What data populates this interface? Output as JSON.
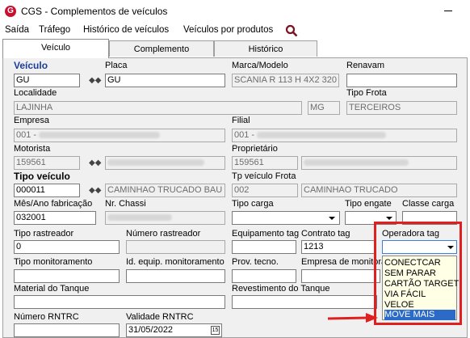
{
  "window": {
    "title": "CGS - Complementos de veículos",
    "logo_letter": "G"
  },
  "menu": [
    "Saída",
    "Tráfego",
    "Histórico de veículos",
    "Veículos por produtos"
  ],
  "tabs": [
    "Veículo",
    "Complemento",
    "Histórico"
  ],
  "form": {
    "veiculo": {
      "label": "Veículo",
      "value": "GU"
    },
    "placa": {
      "label": "Placa",
      "value": "GU"
    },
    "marca_modelo": {
      "label": "Marca/Modelo",
      "value": "SCANIA R 113 H 4X2 320"
    },
    "renavam": {
      "label": "Renavam",
      "value": ""
    },
    "localidade": {
      "label": "Localidade",
      "value": "LAJINHA",
      "uf": "MG"
    },
    "tipo_frota": {
      "label": "Tipo Frota",
      "value": "TERCEIROS"
    },
    "empresa": {
      "label": "Empresa",
      "value": "001 -"
    },
    "filial": {
      "label": "Filial",
      "value": "001 -"
    },
    "motorista": {
      "label": "Motorista",
      "value": "159561"
    },
    "proprietario": {
      "label": "Proprietário",
      "value": "159561"
    },
    "tipo_veiculo": {
      "label": "Tipo veículo",
      "code": "000011",
      "desc": "CAMINHAO TRUCADO BAU"
    },
    "tp_veiculo_frota": {
      "label": "Tp veículo Frota",
      "code": "002",
      "desc": "CAMINHAO TRUCADO"
    },
    "mes_ano_fabricacao": {
      "label": "Mês/Ano fabricação",
      "value": "032001"
    },
    "nr_chassi": {
      "label": "Nr. Chassi",
      "value": ""
    },
    "tipo_carga": {
      "label": "Tipo carga",
      "value": ""
    },
    "tipo_engate": {
      "label": "Tipo engate",
      "value": ""
    },
    "classe_carga": {
      "label": "Classe carga",
      "value": ""
    },
    "tipo_rastreador": {
      "label": "Tipo rastreador",
      "value": "0"
    },
    "numero_rastreador": {
      "label": "Número rastreador",
      "value": ""
    },
    "equipamento_tag": {
      "label": "Equipamento tag",
      "value": ""
    },
    "contrato_tag": {
      "label": "Contrato tag",
      "value": "1213"
    },
    "operadora_tag": {
      "label": "Operadora tag",
      "value": ""
    },
    "tipo_monitoramento": {
      "label": "Tipo monitoramento",
      "value": ""
    },
    "id_equip_monitoramento": {
      "label": "Id. equip. monitoramento",
      "value": ""
    },
    "prov_tecno": {
      "label": "Prov. tecno.",
      "value": ""
    },
    "empresa_monitora": {
      "label": "Empresa de monitora",
      "value": ""
    },
    "material_tanque": {
      "label": "Material do Tanque",
      "value": ""
    },
    "revestimento_tanque": {
      "label": "Revestimento do Tanque",
      "value": ""
    },
    "numero_rntrc": {
      "label": "Número RNTRC",
      "value": ""
    },
    "validade_rntrc": {
      "label": "Validade RNTRC",
      "value": "31/05/2022"
    }
  },
  "operadora_options": [
    "CONECTCAR",
    "SEM PARAR",
    "CARTÃO TARGET",
    "VIA FÁCIL",
    "VELOE",
    "MOVE MAIS"
  ],
  "operadora_selected_index": 5,
  "colors": {
    "highlight": "#e02020",
    "selection": "#2b6bc7",
    "label_blue": "#1a3c9a"
  }
}
